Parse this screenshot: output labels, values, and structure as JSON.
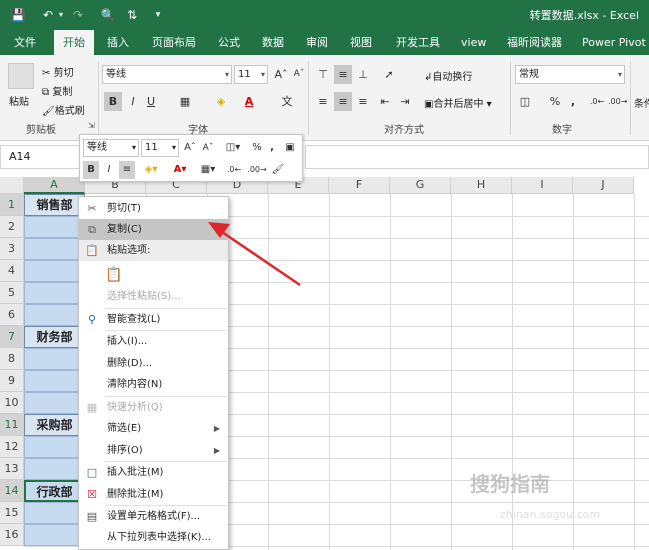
{
  "title_bar": {
    "filename": "转置数据.xlsx",
    "app": "Excel",
    "separator": " - "
  },
  "ribbon_tabs": [
    "文件",
    "开始",
    "插入",
    "页面布局",
    "公式",
    "数据",
    "审阅",
    "视图",
    "开发工具",
    "view",
    "福昕阅读器",
    "Power Pivot"
  ],
  "active_tab": "开始",
  "clipboard": {
    "paste": "粘贴",
    "cut": "剪切",
    "copy": "复制",
    "format_painter": "格式刷",
    "label": "剪贴板"
  },
  "font_group": {
    "font_name": "等线",
    "font_size": "11",
    "label": "字体",
    "bold": "B",
    "italic": "I",
    "underline": "U"
  },
  "alignment_group": {
    "wrap_text": "自动换行",
    "merge_center": "合并后居中",
    "label": "对齐方式"
  },
  "number_group": {
    "format": "常规",
    "label": "数字",
    "percent": "%",
    "comma": ","
  },
  "conditional_format_label": "条件",
  "name_box": "A14",
  "columns": [
    "A",
    "B",
    "C",
    "D",
    "E",
    "F",
    "G",
    "H",
    "I",
    "J"
  ],
  "rows": [
    "1",
    "2",
    "3",
    "4",
    "5",
    "6",
    "7",
    "8",
    "9",
    "10",
    "11",
    "12",
    "13",
    "14",
    "15",
    "16"
  ],
  "departments": {
    "1": "销售部",
    "7": "财务部",
    "11": "采购部",
    "14": "行政部"
  },
  "mini_toolbar": {
    "font_name": "等线",
    "font_size": "11",
    "percent": "%",
    "comma": ",",
    "bold": "B",
    "italic": "I"
  },
  "context_menu": [
    {
      "label": "剪切(T)",
      "icon": "scissors-icon"
    },
    {
      "label": "复制(C)",
      "icon": "copy-icon",
      "highlighted": true
    },
    {
      "label": "粘贴选项:",
      "icon": "paste-icon",
      "section": true
    },
    {
      "label": "",
      "icon": "paste-clipboard-icon"
    },
    {
      "label": "选择性粘贴(S)...",
      "disabled": true
    },
    {
      "label": "智能查找(L)",
      "icon": "smart-lookup-icon"
    },
    {
      "label": "插入(I)..."
    },
    {
      "label": "删除(D)..."
    },
    {
      "label": "清除内容(N)"
    },
    {
      "label": "快速分析(Q)",
      "icon": "quick-analysis-icon",
      "disabled": true
    },
    {
      "label": "筛选(E)",
      "submenu": true
    },
    {
      "label": "排序(O)",
      "submenu": true
    },
    {
      "label": "插入批注(M)",
      "icon": "insert-comment-icon"
    },
    {
      "label": "删除批注(M)",
      "icon": "delete-comment-icon"
    },
    {
      "label": "设置单元格格式(F)...",
      "icon": "format-cells-icon"
    },
    {
      "label": "从下拉列表中选择(K)..."
    }
  ],
  "watermark": {
    "text": "搜狗指南",
    "url": "zhinan.sogou.com"
  },
  "colors": {
    "excel_green": "#217346",
    "selection_blue": "#c6dbef",
    "arrow_red": "#e0262b"
  }
}
